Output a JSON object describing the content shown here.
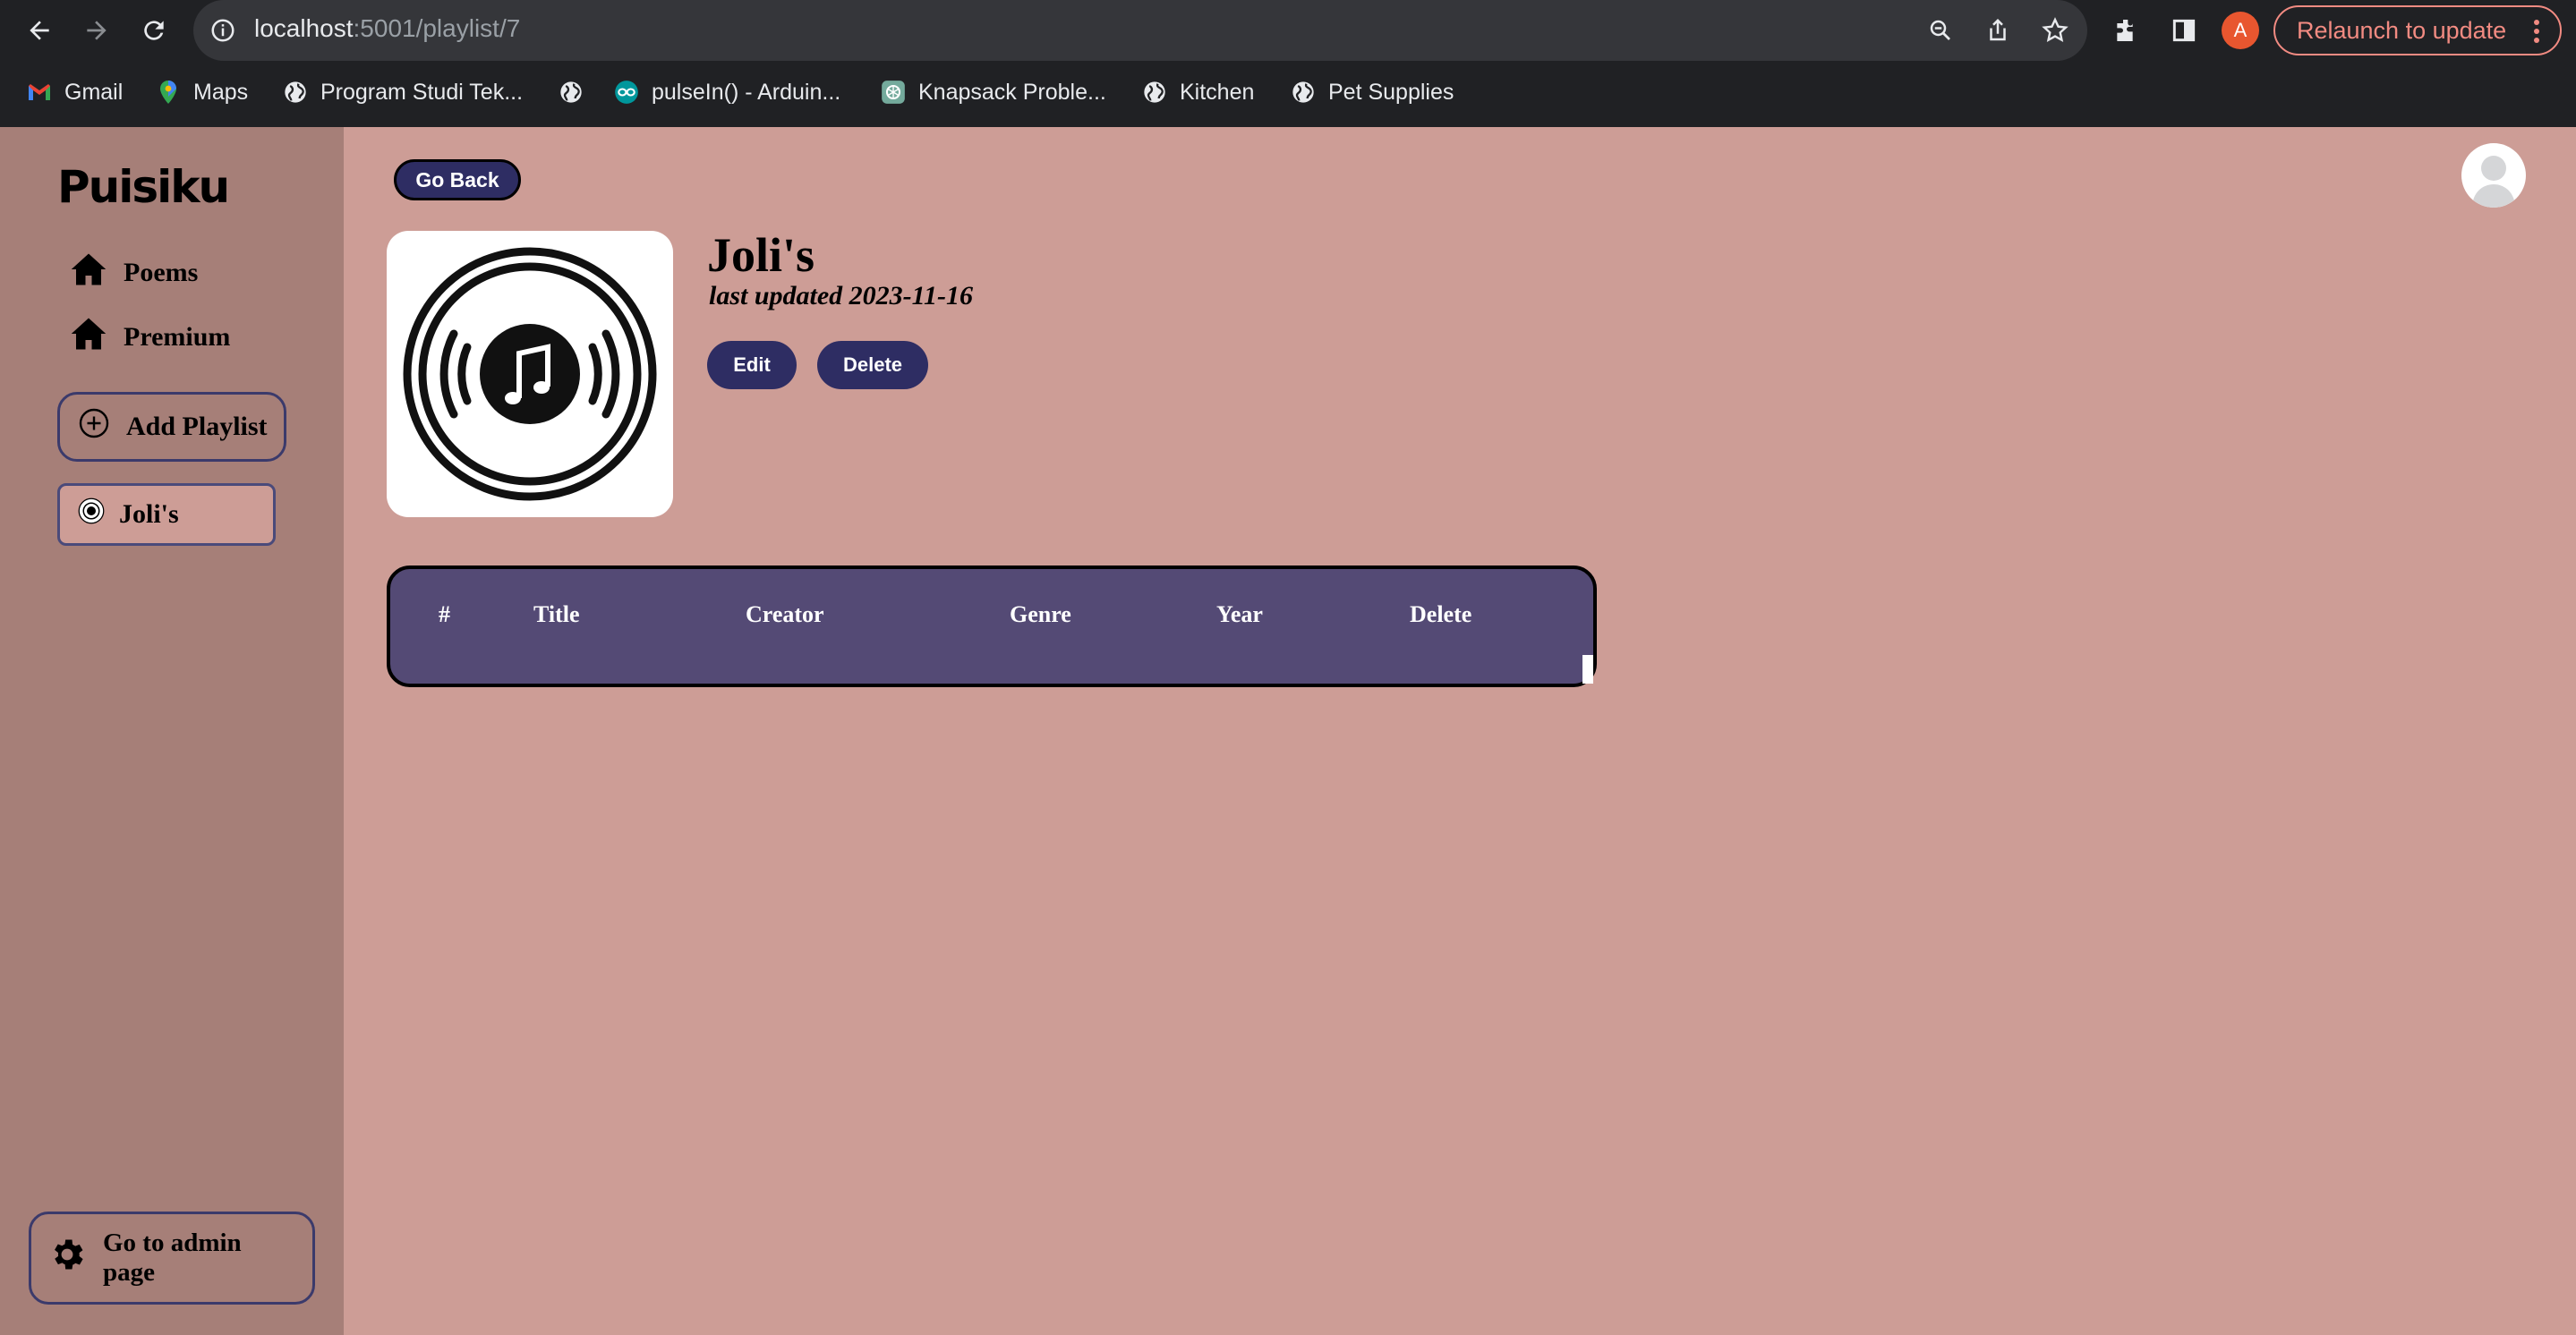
{
  "browser": {
    "url_host": "localhost",
    "url_path": ":5001/playlist/7",
    "profile_initial": "A",
    "relaunch_label": "Relaunch to update",
    "bookmarks": [
      {
        "label": "Gmail",
        "icon": "gmail-icon"
      },
      {
        "label": "Maps",
        "icon": "maps-icon"
      },
      {
        "label": "Program Studi Tek...",
        "icon": "globe-icon"
      },
      {
        "label": "",
        "icon": "globe-icon"
      },
      {
        "label": "pulseIn() - Arduin...",
        "icon": "arduino-icon"
      },
      {
        "label": "Knapsack Proble...",
        "icon": "openai-icon"
      },
      {
        "label": "Kitchen",
        "icon": "globe-icon"
      },
      {
        "label": "Pet Supplies",
        "icon": "globe-icon"
      }
    ]
  },
  "app": {
    "logo": "Puisiku",
    "nav": [
      {
        "label": "Poems",
        "icon": "home-icon"
      },
      {
        "label": "Premium",
        "icon": "home-icon"
      }
    ],
    "add_playlist_label": "Add Playlist",
    "playlists": [
      {
        "label": "Joli's",
        "icon": "vinyl-icon"
      }
    ],
    "admin_label": "Go to admin page"
  },
  "main": {
    "go_back_label": "Go Back",
    "playlist_title": "Joli's",
    "last_updated": "last updated 2023-11-16",
    "edit_label": "Edit",
    "delete_label": "Delete",
    "table_columns": [
      "#",
      "Title",
      "Creator",
      "Genre",
      "Year",
      "Delete"
    ]
  },
  "colors": {
    "page_bg": "#cd9d96",
    "sidebar_bg": "#a67f78",
    "button_bg": "#2e2d63",
    "table_bg": "#544a75",
    "chrome_bg": "#202124"
  }
}
